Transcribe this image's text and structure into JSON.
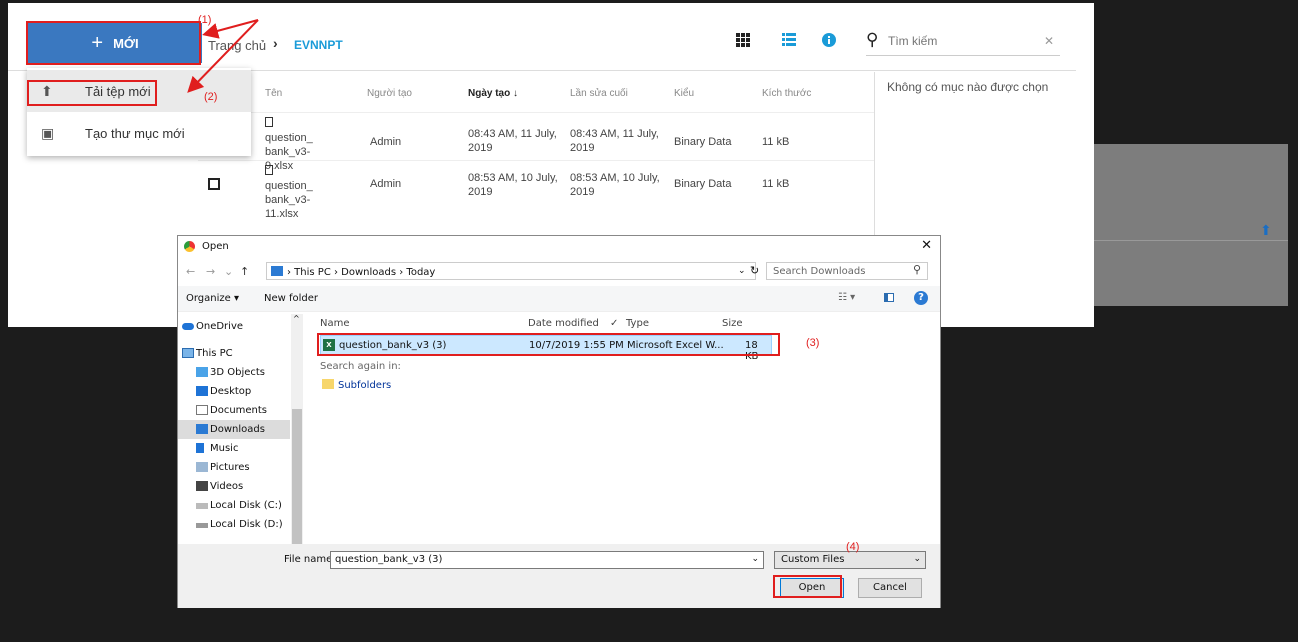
{
  "file_manager": {
    "new_button": "MỚI",
    "breadcrumb": {
      "root": "Trang chủ",
      "current": "EVNNPT"
    },
    "search": {
      "placeholder": "Tìm kiếm"
    },
    "details_empty": "Không có mục nào được chọn",
    "columns": {
      "name": "Tên",
      "creator": "Người tạo",
      "created": "Ngày tạo ↓",
      "modified": "Lần sửa cuối",
      "type": "Kiểu",
      "size": "Kích thước"
    },
    "rows": [
      {
        "name": "question_bank_v3-9.xlsx",
        "creator": "Admin",
        "created": "08:43 AM, 11 July, 2019",
        "modified": "08:43 AM, 11 July, 2019",
        "type": "Binary Data",
        "size": "11 kB"
      },
      {
        "name": "question_bank_v3-11.xlsx",
        "creator": "Admin",
        "created": "08:53 AM, 10 July, 2019",
        "modified": "08:53 AM, 10 July, 2019",
        "type": "Binary Data",
        "size": "11 kB"
      }
    ],
    "menu": {
      "upload": "Tải tệp mới",
      "new_folder": "Tạo thư mục mới"
    }
  },
  "annotations": {
    "a1": "(1)",
    "a2": "(2)",
    "a3": "(3)",
    "a4": "(4)"
  },
  "dialog": {
    "title": "Open",
    "path": "› This PC › Downloads › Today",
    "search_placeholder": "Search Downloads",
    "organize": "Organize ▾",
    "new_folder": "New folder",
    "nav": [
      "OneDrive",
      "This PC",
      "3D Objects",
      "Desktop",
      "Documents",
      "Downloads",
      "Music",
      "Pictures",
      "Videos",
      "Local Disk (C:)",
      "Local Disk (D:)"
    ],
    "headers": {
      "name": "Name",
      "date": "Date modified",
      "type": "Type",
      "size": "Size"
    },
    "file": {
      "name": "question_bank_v3 (3)",
      "date": "10/7/2019 1:55 PM",
      "type": "Microsoft Excel W...",
      "size": "18 KB"
    },
    "search_again": "Search again in:",
    "subfolders": "Subfolders",
    "file_name_label": "File name:",
    "file_name_value": "question_bank_v3 (3)",
    "file_type": "Custom Files",
    "open_button": "Open",
    "cancel_button": "Cancel"
  },
  "colors": {
    "accent": "#3a78c0",
    "annotation": "#e01e1e",
    "link": "#1a9bd8"
  }
}
